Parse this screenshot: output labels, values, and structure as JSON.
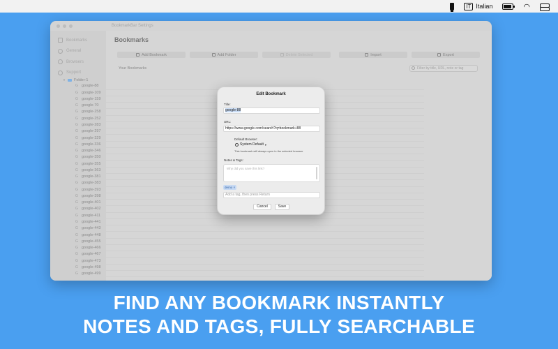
{
  "menubar": {
    "lang_code": "IT",
    "lang_name": "Italian"
  },
  "window": {
    "title": "BookmarkBar Settings",
    "sidebar": [
      {
        "label": "Bookmarks",
        "icon": "bookmark-icon"
      },
      {
        "label": "General",
        "icon": "gear-icon"
      },
      {
        "label": "Browsers",
        "icon": "check-circle-icon"
      },
      {
        "label": "Support",
        "icon": "help-icon"
      }
    ],
    "page_title": "Bookmarks",
    "toolbar": {
      "add_bookmark": "Add Bookmark",
      "add_folder": "Add Folder",
      "delete_selected": "Delete Selected",
      "import": "Import",
      "export": "Export"
    },
    "subhead": "Your Bookmarks",
    "filter_placeholder": "Filter by title, URL, note or tag",
    "folder": "Folder-1",
    "bookmarks": [
      "google-88",
      "google-109",
      "google-159",
      "google-70",
      "google-258",
      "google-252",
      "google-283",
      "google-297",
      "google-329",
      "google-336",
      "google-346",
      "google-350",
      "google-355",
      "google-363",
      "google-381",
      "google-383",
      "google-393",
      "google-398",
      "google-401",
      "google-402",
      "google-411",
      "google-441",
      "google-443",
      "google-448",
      "google-455",
      "google-466",
      "google-467",
      "google-473",
      "google-498",
      "google-499"
    ]
  },
  "modal": {
    "title": "Edit Bookmark",
    "title_label": "Title:",
    "title_value": "google-88",
    "url_label": "URL:",
    "url_value": "https://www.google.com/search?q=bookmark+88",
    "browser_label": "Default Browser:",
    "browser_value": "System Default",
    "browser_hint": "This bookmark will always open in the selected browser",
    "notes_label": "Notes & Tags:",
    "notes_placeholder": "Why did you save this link?",
    "tag": "demo",
    "tag_placeholder": "Add a tag, then press Return",
    "cancel": "Cancel",
    "save": "Save"
  },
  "caption": {
    "line1": "FIND ANY BOOKMARK INSTANTLY",
    "line2": "NOTES AND TAGS, FULLY SEARCHABLE"
  }
}
